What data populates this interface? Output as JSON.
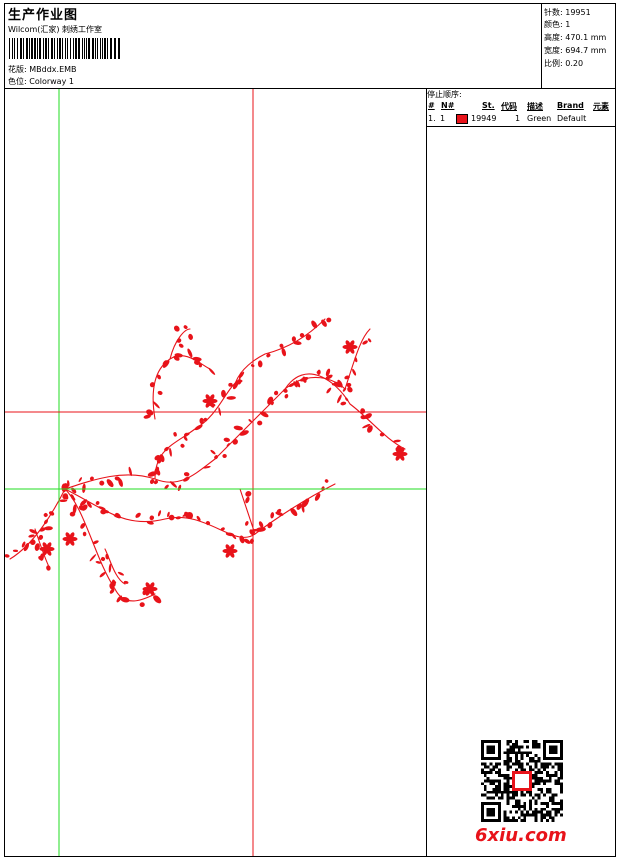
{
  "header": {
    "title": "生产作业图",
    "subtitle": "Wilcom(汇家) 刺绣工作室",
    "design_label": "花版:",
    "design_value": "MBddx.EMB",
    "colorway_label": "色位:",
    "colorway_value": "Colorway 1"
  },
  "stats": {
    "stitches_label": "针数:",
    "stitches_value": "19951",
    "colors_label": "颜色:",
    "colors_value": "1",
    "height_label": "高度:",
    "height_value": "470.1 mm",
    "width_label": "宽度:",
    "width_value": "694.7 mm",
    "scale_label": "比例:",
    "scale_value": "0.20"
  },
  "sequence": {
    "heading": "停止顺序:",
    "columns": {
      "hash": "#",
      "no": "N#",
      "st": "St.",
      "code": "代码",
      "desc": "描述",
      "brand": "Brand",
      "elem": "元素"
    },
    "rows": [
      {
        "idx": "1.",
        "n": "1",
        "color": "#e8131a",
        "stitches": "19949",
        "code": "1",
        "desc": "Green",
        "brand": "Default"
      }
    ]
  },
  "design": {
    "thread_color": "#e8131a",
    "vertical_guide_color": "#e8131a",
    "horizontal_guide_color": "#22dd22"
  },
  "watermark": {
    "text": "6xiu.com"
  }
}
